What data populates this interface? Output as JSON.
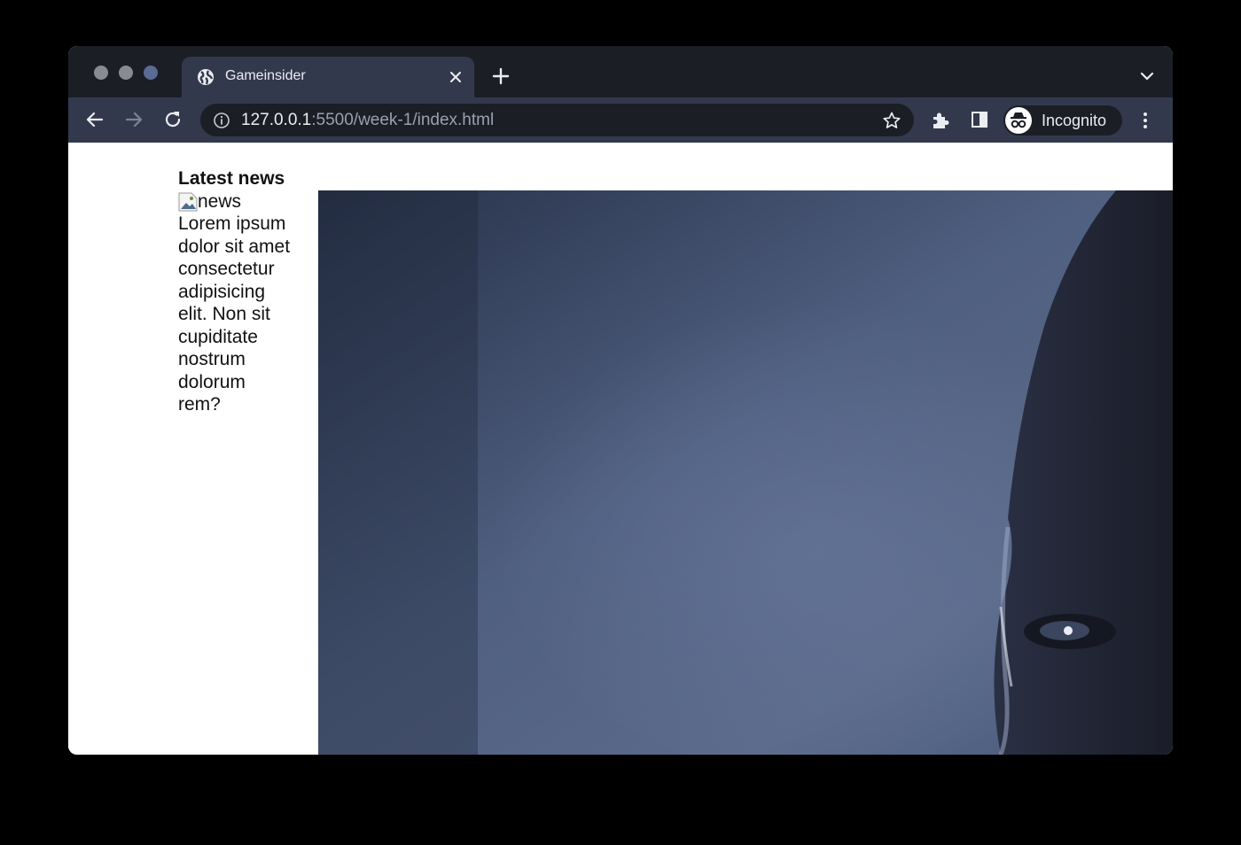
{
  "browser": {
    "tab": {
      "title": "Gameinsider",
      "icon": "globe-icon"
    },
    "address_bar": {
      "url_host": "127.0.0.1",
      "url_path": ":5500/week-1/index.html"
    },
    "profile": {
      "label": "Incognito",
      "icon": "incognito-icon"
    }
  },
  "page": {
    "news": {
      "heading": "Latest news",
      "image_alt": "news",
      "text": "Lorem ipsum dolor sit amet consectetur adipisicing elit. Non sit cupiditate nostrum dolorum rem?"
    },
    "hero": {
      "description_icon": "hero-image"
    }
  },
  "colors": {
    "tabstrip": "#1c1e26",
    "toolbar": "#33394d",
    "omnibox": "#1c1e26",
    "hero_light": "#55627f",
    "hero_dark": "#23283a"
  }
}
